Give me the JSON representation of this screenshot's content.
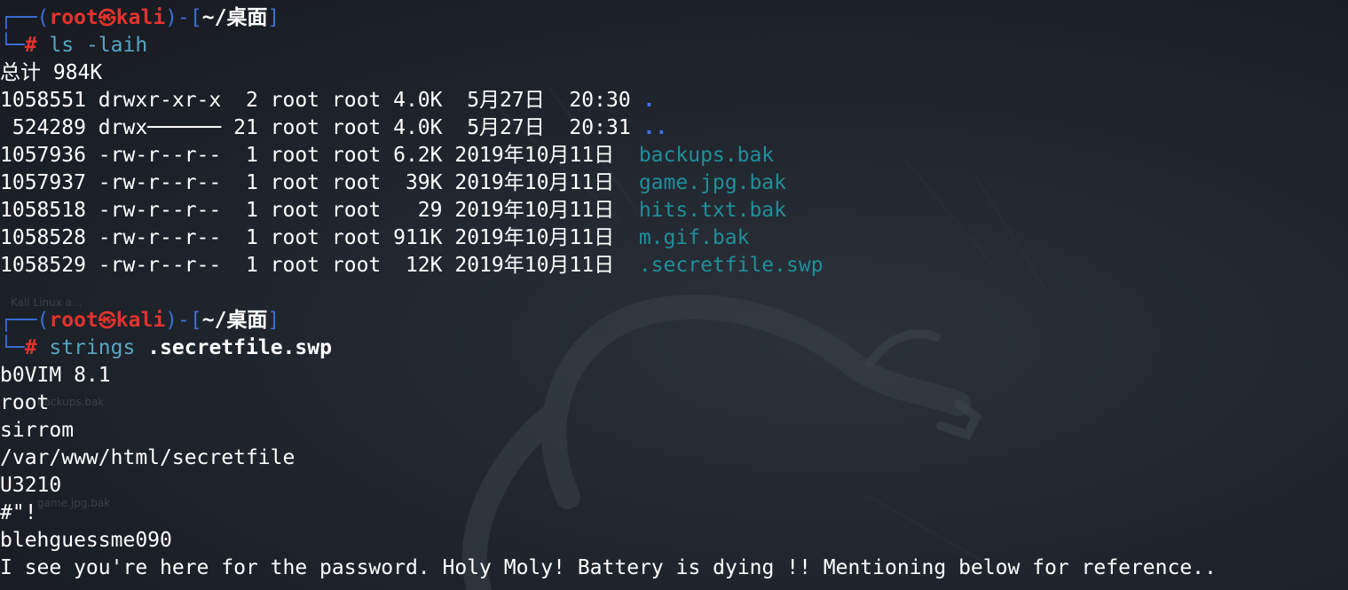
{
  "prompt1": {
    "frame_left": "┌──(",
    "user": "root",
    "at_symbol": "㉿",
    "host": "kali",
    "sep": ")-[",
    "cwd": "~/桌面",
    "frame_right": "]",
    "corner": "└─",
    "hash": "#",
    "command": "ls -laih"
  },
  "total": "总计 984K",
  "listing": [
    {
      "meta": "1058551 drwxr-xr-x  2 root root 4.0K  5月27日  20:30 ",
      "name": ".",
      "kind": "dir"
    },
    {
      "meta": " 524289 drwx────── 21 root root 4.0K  5月27日  20:31 ",
      "name": "..",
      "kind": "dir"
    },
    {
      "meta": "1057936 -rw-r--r--  1 root root 6.2K 2019年10月11日  ",
      "name": "backups.bak",
      "kind": "file"
    },
    {
      "meta": "1057937 -rw-r--r--  1 root root  39K 2019年10月11日  ",
      "name": "game.jpg.bak",
      "kind": "file"
    },
    {
      "meta": "1058518 -rw-r--r--  1 root root   29 2019年10月11日  ",
      "name": "hits.txt.bak",
      "kind": "file"
    },
    {
      "meta": "1058528 -rw-r--r--  1 root root 911K 2019年10月11日  ",
      "name": "m.gif.bak",
      "kind": "file"
    },
    {
      "meta": "1058529 -rw-r--r--  1 root root  12K 2019年10月11日  ",
      "name": ".secretfile.swp",
      "kind": "file"
    }
  ],
  "prompt2": {
    "frame_left": "┌──(",
    "user": "root",
    "at_symbol": "㉿",
    "host": "kali",
    "sep": ")-[",
    "cwd": "~/桌面",
    "frame_right": "]",
    "corner": "└─",
    "hash": "#",
    "command": "strings",
    "argument": ".secretfile.swp"
  },
  "output": [
    "b0VIM 8.1",
    "root",
    "sirrom",
    "/var/www/html/secretfile",
    "U3210",
    "#\"!",
    "blehguessme090",
    "I see you're here for the password. Holy Moly! Battery is dying !! Mentioning below for reference.."
  ],
  "background_ghost_labels": [
    "Kali Linux a...",
    "backups.bak",
    "game.jpg.bak"
  ],
  "colors": {
    "background": "#1c2028",
    "prompt_frame": "#3a6fd8",
    "prompt_user": "#e2332d",
    "command": "#58a6c4",
    "file": "#1f8f9b",
    "directory": "#3d72e0",
    "text": "#ffffff"
  }
}
